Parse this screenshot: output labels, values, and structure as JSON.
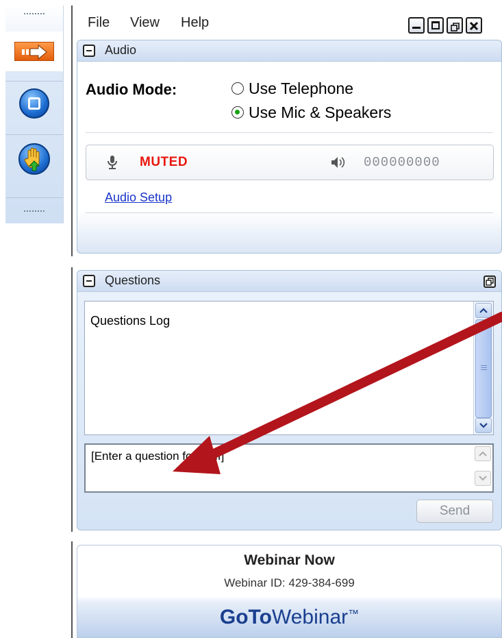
{
  "menu": {
    "file": "File",
    "view": "View",
    "help": "Help"
  },
  "audio": {
    "title": "Audio",
    "mode_label": "Audio Mode:",
    "options": [
      "Use Telephone",
      "Use Mic & Speakers"
    ],
    "selected": "Use Mic & Speakers",
    "mic_status": "MUTED",
    "speaker_value": "000000000",
    "setup_link": "Audio Setup"
  },
  "questions": {
    "title": "Questions",
    "log_label": "Questions Log",
    "input_placeholder": "[Enter a question for staff]",
    "send_label": "Send"
  },
  "footer": {
    "webinar_title": "Webinar Now",
    "webinar_id": "Webinar ID: 429-384-699",
    "brand_goto": "GoTo",
    "brand_webinar": "Webinar",
    "brand_tm": "™"
  },
  "colors": {
    "muted": "#e8170f",
    "link": "#1a35c8",
    "radio_selected": "#16a312",
    "annotation_arrow": "#b3151c",
    "brand": "#1a3f8f"
  },
  "icons": [
    "show-hide-control-panel-icon",
    "stop-screen-icon",
    "raise-hand-icon",
    "microphone-icon",
    "speaker-icon",
    "minimize-icon",
    "maximize-icon",
    "restore-icon",
    "close-icon",
    "collapse-icon",
    "popout-icon"
  ]
}
